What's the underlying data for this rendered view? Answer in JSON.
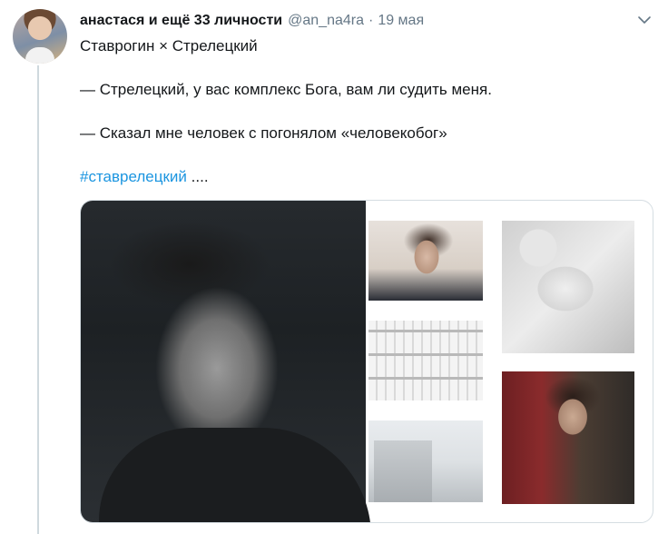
{
  "tweet": {
    "display_name": "анастася и ещё 33 личности",
    "handle": "@an_na4ra",
    "separator": "·",
    "date": "19 мая",
    "lines": [
      "Ставрогин × Стрелецкий",
      "— Стрелецкий, у вас комплекс Бога, вам ли судить меня.",
      "— Сказал мне человек с погонялом «человекобог»"
    ],
    "hashtag": "#ставрелецкий",
    "hashtag_suffix": " ...."
  },
  "icons": {
    "menu": "chevron-down-icon"
  },
  "colors": {
    "link": "#1b95e0",
    "secondary_text": "#657786",
    "border": "#d5dde2"
  }
}
